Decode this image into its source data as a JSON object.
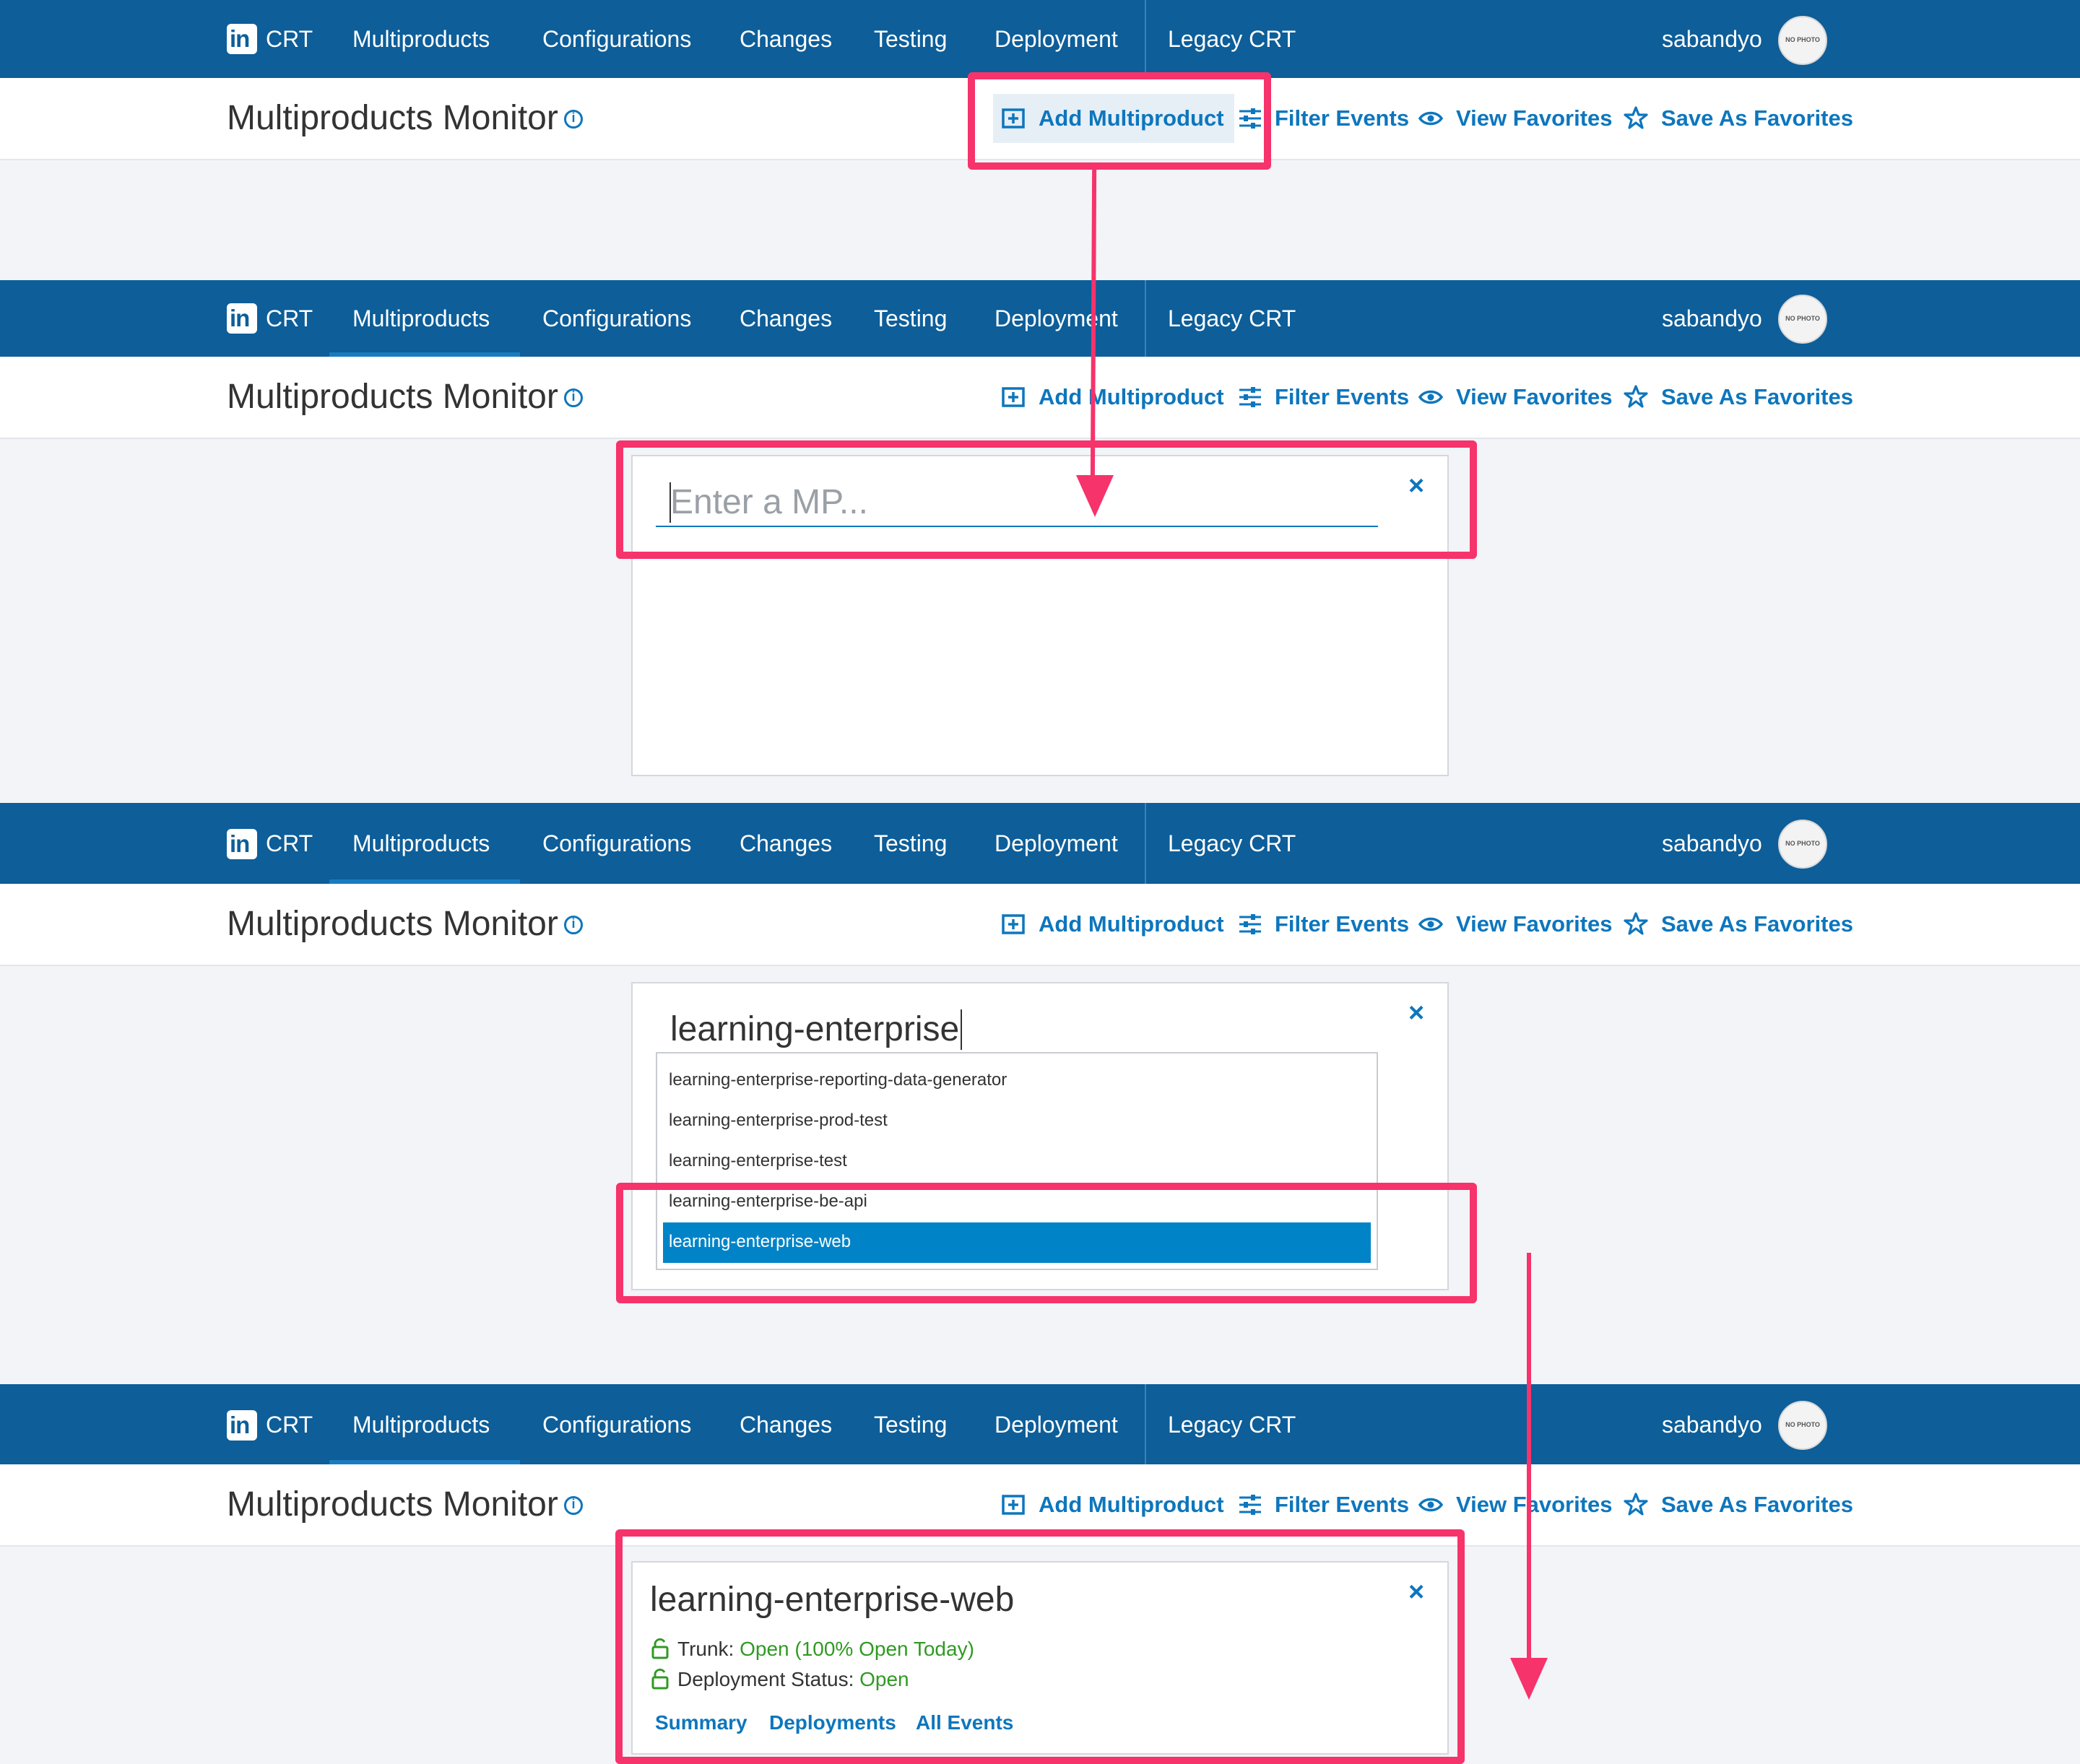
{
  "nav": {
    "brand": "CRT",
    "items": [
      "Multiproducts",
      "Configurations",
      "Changes",
      "Testing",
      "Deployment",
      "Legacy CRT"
    ],
    "user": "sabandyo",
    "avatar_text": "NO PHOTO"
  },
  "header": {
    "title": "Multiproducts Monitor",
    "actions": {
      "add": "Add Multiproduct",
      "filter": "Filter Events",
      "view_favorites": "View Favorites",
      "save_favorites": "Save As Favorites"
    }
  },
  "step2": {
    "input_placeholder": "Enter a MP..."
  },
  "step3": {
    "input_value": "learning-enterprise",
    "suggestions": [
      "learning-enterprise-reporting-data-generator",
      "learning-enterprise-prod-test",
      "learning-enterprise-test",
      "learning-enterprise-be-api",
      "learning-enterprise-web"
    ],
    "selected_index": 4
  },
  "step4": {
    "mp_name": "learning-enterprise-web",
    "trunk_label": "Trunk:",
    "trunk_value": "Open (100% Open Today)",
    "deploy_label": "Deployment Status:",
    "deploy_value": "Open",
    "links": [
      "Summary",
      "Deployments",
      "All Events"
    ]
  },
  "colors": {
    "nav_bg": "#0d5e99",
    "accent": "#0d76bd",
    "highlight": "#f6336b",
    "open_status": "#2f9a22",
    "selected_row": "#0084c7"
  },
  "icons": [
    "linkedin-logo-icon",
    "info-icon",
    "add-box-icon",
    "sliders-icon",
    "eye-icon",
    "star-icon",
    "close-icon",
    "unlock-icon"
  ]
}
